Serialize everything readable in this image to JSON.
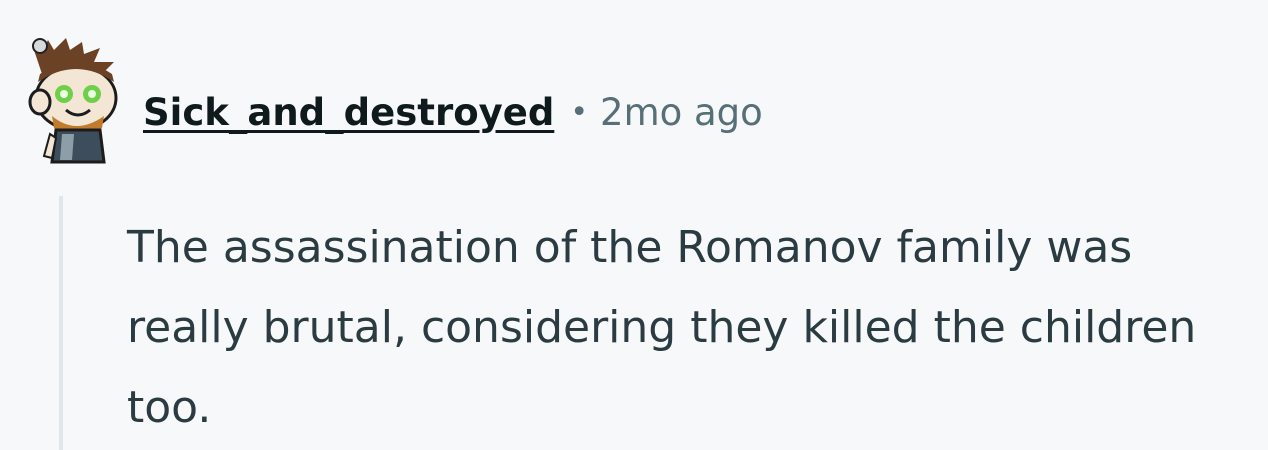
{
  "comment": {
    "author": "Sick_and_destroyed",
    "separator": "•",
    "time": "2mo ago",
    "body": "The assassination of the Romanov family was really brutal, considering they killed the children too.",
    "avatar_icon": "snoo-avatar-icon"
  },
  "colors": {
    "background": "#f7f8fa",
    "author": "#0f1a1c",
    "meta": "#576f76",
    "body": "#2a3c42",
    "thread_line": "#e0e6ea"
  }
}
